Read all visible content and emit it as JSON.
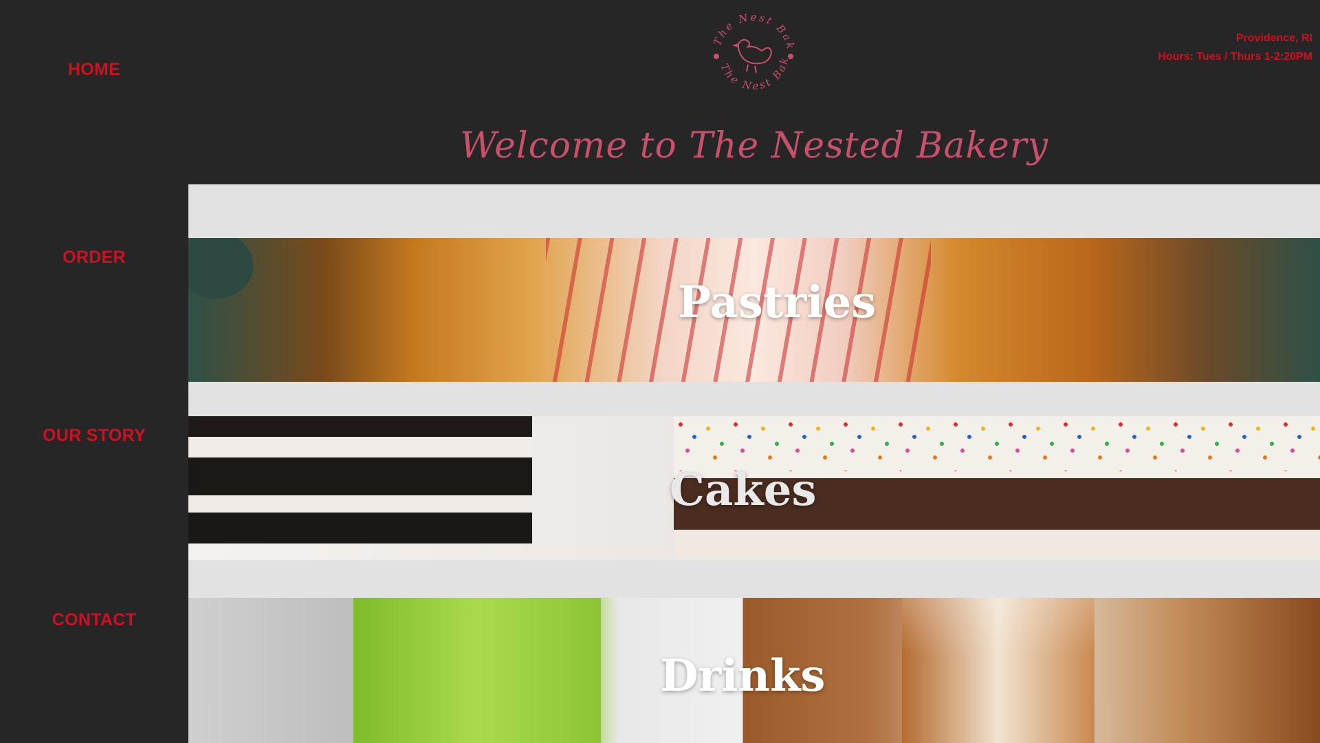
{
  "nav": {
    "home": "HOME",
    "order": "ORDER",
    "our_story": "OUR STORY",
    "contact": "CONTACT"
  },
  "header": {
    "logo_text_top": "The Nest Bakery",
    "logo_text_bottom": "The Nest Bakery",
    "title": "Welcome to The Nested Bakery",
    "location": "Providence, RI",
    "hours": "Hours: Tues / Thurs 1-2:20PM"
  },
  "categories": {
    "pastries": "Pastries",
    "cakes": "Cakes",
    "drinks": "Drinks"
  },
  "colors": {
    "nav_red": "#cf1020",
    "title_pink": "#c9506a",
    "background": "#262626"
  }
}
